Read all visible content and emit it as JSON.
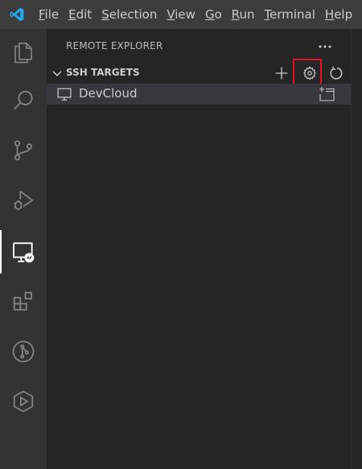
{
  "menu": {
    "items": [
      {
        "mnemonic": "F",
        "rest": "ile"
      },
      {
        "mnemonic": "E",
        "rest": "dit"
      },
      {
        "mnemonic": "S",
        "rest": "election"
      },
      {
        "mnemonic": "V",
        "rest": "iew"
      },
      {
        "mnemonic": "G",
        "rest": "o"
      },
      {
        "mnemonic": "R",
        "rest": "un"
      },
      {
        "mnemonic": "T",
        "rest": "erminal"
      },
      {
        "mnemonic": "H",
        "rest": "elp"
      }
    ]
  },
  "activity_bar": {
    "icons": [
      "explorer-icon",
      "search-icon",
      "source-control-icon",
      "run-debug-icon",
      "remote-explorer-icon",
      "extensions-icon",
      "git-graph-icon",
      "live-share-icon"
    ],
    "active": "remote-explorer-icon"
  },
  "sidebar": {
    "title": "REMOTE EXPLORER",
    "section": {
      "title": "SSH TARGETS",
      "actions": [
        "add-icon",
        "gear-icon",
        "refresh-icon"
      ]
    },
    "targets": [
      {
        "label": "DevCloud"
      }
    ]
  },
  "colors": {
    "accent": "#0065a9",
    "highlight_border": "#e81123",
    "selection": "#37373d"
  }
}
